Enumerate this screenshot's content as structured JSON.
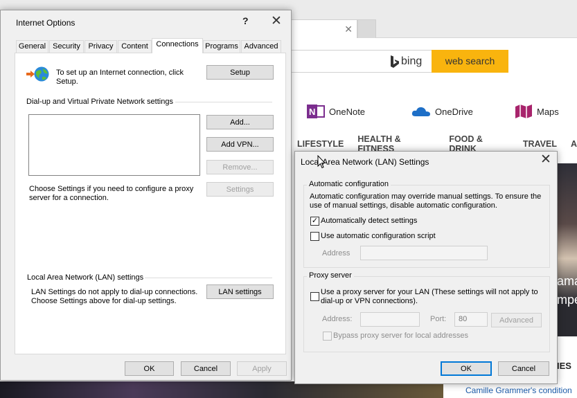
{
  "browser": {
    "bing_label": "bing",
    "web_search": "web search",
    "apps": [
      {
        "name": "OneNote",
        "color": "#7b2d8e"
      },
      {
        "name": "OneDrive",
        "color": "#1e6fc7"
      },
      {
        "name": "Maps",
        "color": "#a8246c"
      }
    ],
    "nav": [
      "LIFESTYLE",
      "HEALTH & FITNESS",
      "FOOD & DRINK",
      "TRAVEL",
      "A"
    ],
    "news_txt1": "ama",
    "news_txt2": "mpe",
    "ies": "IES",
    "camille": "Camille Grammer's condition"
  },
  "internet_options": {
    "title": "Internet Options",
    "help": "?",
    "tabs": [
      "General",
      "Security",
      "Privacy",
      "Content",
      "Connections",
      "Programs",
      "Advanced"
    ],
    "active_tab": "Connections",
    "setup_text": "To set up an Internet connection, click Setup.",
    "setup_btn": "Setup",
    "dialup_header": "Dial-up and Virtual Private Network settings",
    "add_btn": "Add...",
    "add_vpn_btn": "Add VPN...",
    "remove_btn": "Remove...",
    "settings_btn": "Settings",
    "proxy_text": "Choose Settings if you need to configure a proxy server for a connection.",
    "lan_header": "Local Area Network (LAN) settings",
    "lan_text": "LAN Settings do not apply to dial-up connections. Choose Settings above for dial-up settings.",
    "lan_btn": "LAN settings",
    "ok": "OK",
    "cancel": "Cancel",
    "apply": "Apply"
  },
  "lan_settings": {
    "title": "Local Area Network (LAN) Settings",
    "auto_group": "Automatic configuration",
    "auto_desc": "Automatic configuration may override manual settings.  To ensure the use of manual settings, disable automatic configuration.",
    "auto_detect_label": "Automatically detect settings",
    "auto_detect_checked": true,
    "auto_script_label": "Use automatic configuration script",
    "auto_script_checked": false,
    "address_label": "Address",
    "address_value": "",
    "proxy_group": "Proxy server",
    "use_proxy_label": "Use a proxy server for your LAN (These settings will not apply to dial-up or VPN connections).",
    "use_proxy_checked": false,
    "proxy_address_label": "Address:",
    "proxy_address_value": "",
    "port_label": "Port:",
    "port_value": "80",
    "advanced_btn": "Advanced",
    "bypass_label": "Bypass proxy server for local addresses",
    "bypass_checked": false,
    "ok": "OK",
    "cancel": "Cancel"
  }
}
